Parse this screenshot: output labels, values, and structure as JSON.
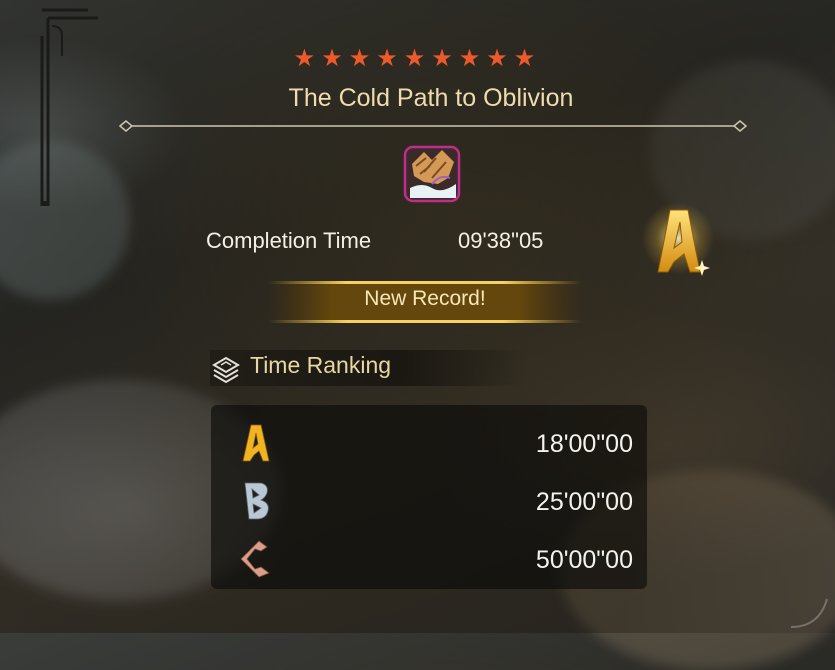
{
  "quest": {
    "stars": "★★★★★★★★★",
    "star_count": 9,
    "title": "The Cold Path to Oblivion"
  },
  "result": {
    "completion_label": "Completion Time",
    "completion_time": "09'38\"05",
    "achieved_rank": "A",
    "record_label": "New Record!"
  },
  "time_ranking": {
    "label": "Time Ranking",
    "rows": [
      {
        "rank": "A",
        "time": "18'00\"00"
      },
      {
        "rank": "B",
        "time": "25'00\"00"
      },
      {
        "rank": "C",
        "time": "50'00\"00"
      }
    ]
  },
  "colors": {
    "star": "#ec5a2c",
    "rank_a": "#f0b423",
    "rank_b": "#b9c8d4",
    "rank_c": "#d8a08a",
    "title": "#efdcae"
  },
  "icons": {
    "monster": "monster-icon",
    "time_ranking": "time-ranking-icon"
  }
}
